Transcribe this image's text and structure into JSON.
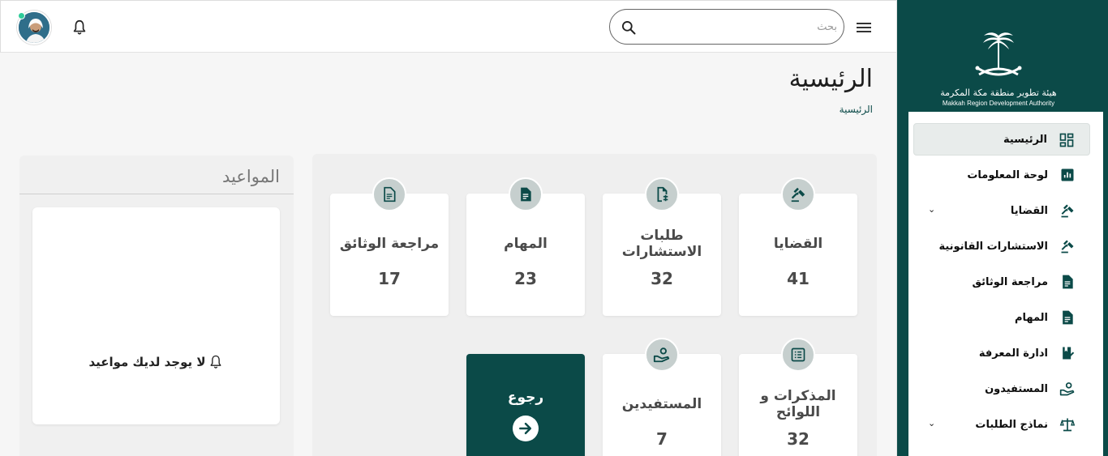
{
  "sidebar": {
    "logo": {
      "ar": "هيئة تطوير منطقة مكة المكرمة",
      "en": "Makkah Region Development Authority"
    },
    "items": [
      {
        "label": "الرئيسية",
        "icon": "dashboard-icon",
        "active": true
      },
      {
        "label": "لوحة المعلومات",
        "icon": "chart-icon"
      },
      {
        "label": "القضايا",
        "icon": "gavel-icon",
        "expandable": true
      },
      {
        "label": "الاستشارات القانونية",
        "icon": "gavel-icon"
      },
      {
        "label": "مراجعة الوثائق",
        "icon": "document-icon"
      },
      {
        "label": "المهام",
        "icon": "document-icon"
      },
      {
        "label": "ادارة المعرفة",
        "icon": "book-check-icon"
      },
      {
        "label": "المستفيدون",
        "icon": "user-hand-icon"
      },
      {
        "label": "نماذج الطلبات",
        "icon": "scale-icon",
        "expandable": true
      }
    ]
  },
  "header": {
    "search_placeholder": "بحث"
  },
  "page": {
    "title": "الرئيسية",
    "breadcrumb": "الرئيسية"
  },
  "appointments": {
    "title": "المواعيد",
    "empty_text": "لا يوجد لديك مواعيد"
  },
  "stats": [
    {
      "title": "القضايا",
      "value": "41",
      "icon": "gavel-icon"
    },
    {
      "title": "طلبات الاستشارات",
      "value": "32",
      "icon": "file-request-icon"
    },
    {
      "title": "المهام",
      "value": "23",
      "icon": "document-icon"
    },
    {
      "title": "مراجعة الوثائق",
      "value": "17",
      "icon": "document-outline-icon"
    },
    {
      "title": "المذكرات و اللوائح",
      "value": "32",
      "icon": "list-icon"
    },
    {
      "title": "المستفيدين",
      "value": "7",
      "icon": "user-hand-icon"
    }
  ],
  "back_button": {
    "label": "رجوع"
  },
  "colors": {
    "primary": "#0b4a48",
    "icon_circle": "#c6cfce"
  }
}
